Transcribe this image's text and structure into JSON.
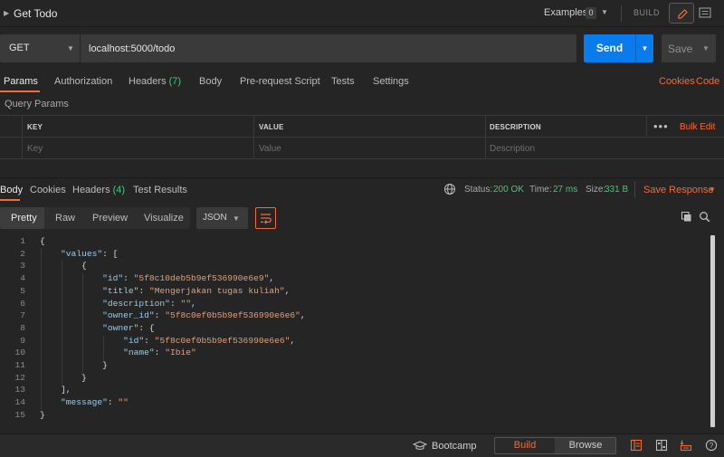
{
  "header": {
    "title": "Get Todo",
    "examples_label": "Examples",
    "examples_count": "0",
    "build_label": "BUILD"
  },
  "request": {
    "method": "GET",
    "url": "localhost:5000/todo",
    "send_label": "Send",
    "save_label": "Save",
    "tabs": [
      {
        "label": "Params"
      },
      {
        "label": "Authorization"
      },
      {
        "label": "Headers",
        "count": "(7)"
      },
      {
        "label": "Body"
      },
      {
        "label": "Pre-request Script"
      },
      {
        "label": "Tests"
      },
      {
        "label": "Settings"
      }
    ],
    "right_links": {
      "cookies": "Cookies",
      "code": "Code"
    },
    "query_params_title": "Query Params",
    "table": {
      "headers": [
        "KEY",
        "VALUE",
        "DESCRIPTION"
      ],
      "placeholders": [
        "Key",
        "Value",
        "Description"
      ],
      "ellipsis": "•••",
      "bulk_edit": "Bulk Edit"
    }
  },
  "response": {
    "tabs": [
      {
        "label": "Body"
      },
      {
        "label": "Cookies"
      },
      {
        "label": "Headers",
        "count": "(4)"
      },
      {
        "label": "Test Results"
      }
    ],
    "status": {
      "label": "Status:",
      "value": "200 OK"
    },
    "time": {
      "label": "Time:",
      "value": "27 ms"
    },
    "size": {
      "label": "Size:",
      "value": "331 B"
    },
    "save_response": "Save Response",
    "formats": [
      "Pretty",
      "Raw",
      "Preview",
      "Visualize"
    ],
    "language": "JSON",
    "code_lines": [
      "{",
      "    \"values\": [",
      "        {",
      "            \"id\": \"5f8c10deb5b9ef536990e6e9\",",
      "            \"title\": \"Mengerjakan tugas kuliah\",",
      "            \"description\": \"\",",
      "            \"owner_id\": \"5f8c0ef0b5b9ef536990e6e6\",",
      "            \"owner\": {",
      "                \"id\": \"5f8c0ef0b5b9ef536990e6e6\",",
      "                \"name\": \"Ibie\"",
      "            }",
      "        }",
      "    ],",
      "    \"message\": \"\"",
      "}"
    ]
  },
  "footer": {
    "bootcamp": "Bootcamp",
    "build": "Build",
    "browse": "Browse"
  },
  "colors": {
    "accent": "#f26b3a",
    "send": "#097bed",
    "success": "#4ec27a"
  }
}
